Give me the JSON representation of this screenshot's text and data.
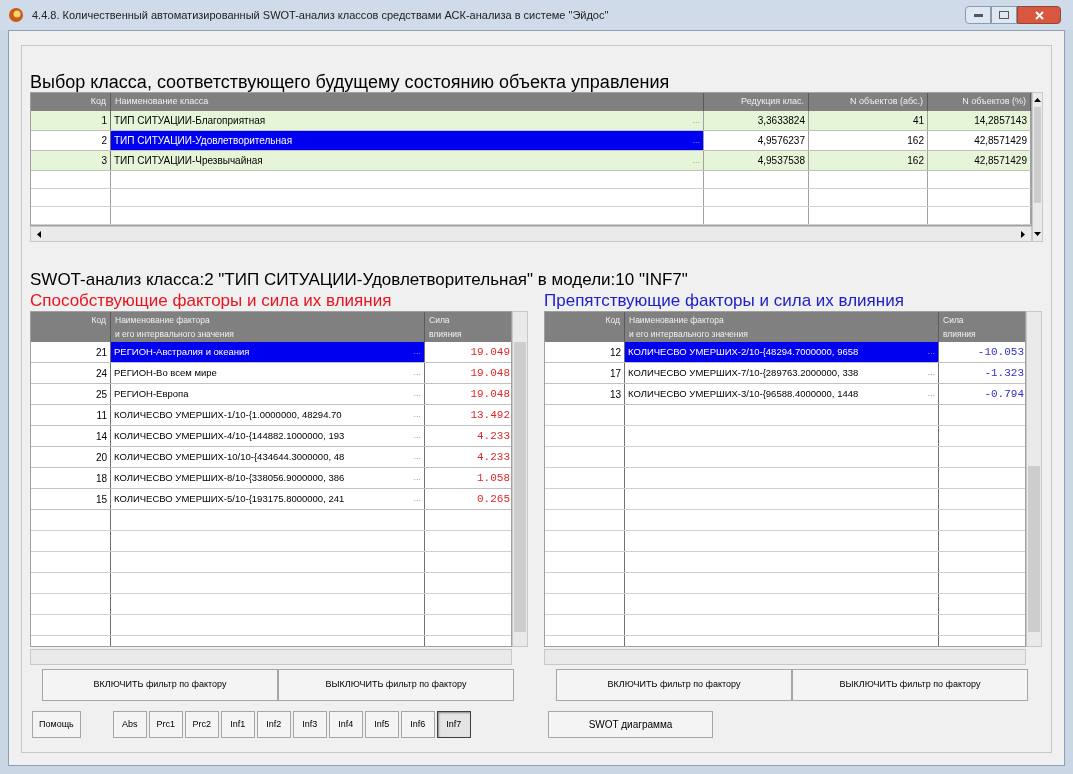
{
  "window": {
    "title": "4.4.8. Количественный автоматизированный SWOT-анализ классов средствами АСК-анализа в системе \"Эйдос\""
  },
  "class_table": {
    "title": "Выбор класса, соответствующего будущему состоянию объекта управления",
    "columns": [
      "Код",
      "Наименование класса",
      "Редукция клас.",
      "N объектов (абс.)",
      "N объектов (%)"
    ],
    "rows": [
      {
        "code": "1",
        "name": "ТИП СИТУАЦИИ-Благоприятная",
        "more": "...",
        "reduction": "3,3633824",
        "n_abs": "41",
        "n_pct": "14,2857143",
        "selected": false
      },
      {
        "code": "2",
        "name": "ТИП СИТУАЦИИ-Удовлетворительная",
        "more": "...",
        "reduction": "4,9576237",
        "n_abs": "162",
        "n_pct": "42,8571429",
        "selected": true
      },
      {
        "code": "3",
        "name": "ТИП СИТУАЦИИ-Чрезвычайная",
        "more": "...",
        "reduction": "4,9537538",
        "n_abs": "162",
        "n_pct": "42,8571429",
        "selected": false
      }
    ]
  },
  "swot_title": "SWOT-анализ класса:2 \"ТИП СИТУАЦИИ-Удовлетворительная\" в модели:10 \"INF7\"",
  "factor_tables": [
    {
      "kind": "positive",
      "title": "Способствующие факторы и сила их влияния",
      "columns": [
        "Код",
        "Наименование фактора\nи его интервального значения",
        "Сила\nвлияния"
      ],
      "rows": [
        {
          "code": "21",
          "name": "РЕГИОН-Австралия и океания",
          "more": "...",
          "strength": "19.049",
          "selected": true
        },
        {
          "code": "24",
          "name": "РЕГИОН-Во всем мире",
          "more": "...",
          "strength": "19.048",
          "selected": false
        },
        {
          "code": "25",
          "name": "РЕГИОН-Европа",
          "more": "...",
          "strength": "19.048",
          "selected": false
        },
        {
          "code": "11",
          "name": "КОЛИЧЕСВО УМЕРШИХ-1/10-{1.0000000, 48294.70",
          "more": "...",
          "strength": "13.492",
          "selected": false
        },
        {
          "code": "14",
          "name": "КОЛИЧЕСВО УМЕРШИХ-4/10-{144882.1000000, 193",
          "more": "...",
          "strength": "4.233",
          "selected": false
        },
        {
          "code": "20",
          "name": "КОЛИЧЕСВО УМЕРШИХ-10/10-{434644.3000000, 48",
          "more": "...",
          "strength": "4.233",
          "selected": false
        },
        {
          "code": "18",
          "name": "КОЛИЧЕСВО УМЕРШИХ-8/10-{338056.9000000, 386",
          "more": "...",
          "strength": "1.058",
          "selected": false
        },
        {
          "code": "15",
          "name": "КОЛИЧЕСВО УМЕРШИХ-5/10-{193175.8000000, 241",
          "more": "...",
          "strength": "0.265",
          "selected": false
        }
      ],
      "buttons": [
        "ВКЛЮЧИТЬ фильтр по фактору",
        "ВЫКЛЮЧИТЬ фильтр по фактору"
      ]
    },
    {
      "kind": "negative",
      "title": "Препятствующие факторы и сила их влияния",
      "columns": [
        "Код",
        "Наименование фактора\nи его интервального значения",
        "Сила\nвлияния"
      ],
      "rows": [
        {
          "code": "12",
          "name": "КОЛИЧЕСВО УМЕРШИХ-2/10-{48294.7000000, 9658",
          "more": "...",
          "strength": "-10.053",
          "selected": true
        },
        {
          "code": "17",
          "name": "КОЛИЧЕСВО УМЕРШИХ-7/10-{289763.2000000, 338",
          "more": "...",
          "strength": "-1.323",
          "selected": false
        },
        {
          "code": "13",
          "name": "КОЛИЧЕСВО УМЕРШИХ-3/10-{96588.4000000, 1448",
          "more": "...",
          "strength": "-0.794",
          "selected": false
        }
      ],
      "buttons": [
        "ВКЛЮЧИТЬ фильтр по фактору",
        "ВЫКЛЮЧИТЬ фильтр по фактору"
      ]
    }
  ],
  "help_button": "Помощь",
  "model_buttons": [
    {
      "label": "Abs",
      "selected": false
    },
    {
      "label": "Prc1",
      "selected": false
    },
    {
      "label": "Prc2",
      "selected": false
    },
    {
      "label": "Inf1",
      "selected": false
    },
    {
      "label": "Inf2",
      "selected": false
    },
    {
      "label": "Inf3",
      "selected": false
    },
    {
      "label": "Inf4",
      "selected": false
    },
    {
      "label": "Inf5",
      "selected": false
    },
    {
      "label": "Inf6",
      "selected": false
    },
    {
      "label": "Inf7",
      "selected": true
    }
  ],
  "diagram_button": "SWOT диаграмма"
}
